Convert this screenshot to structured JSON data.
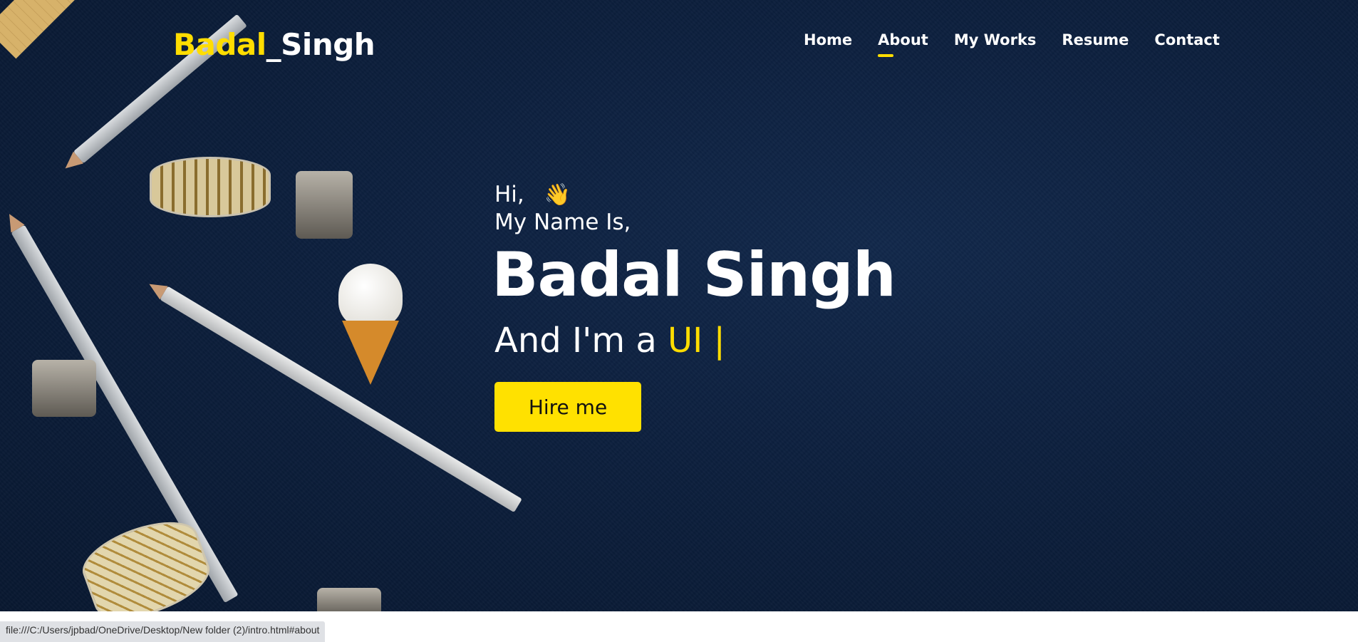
{
  "header": {
    "logo_first": "Badal",
    "logo_sep": "_",
    "logo_last": "Singh",
    "nav": [
      {
        "label": "Home"
      },
      {
        "label": "About"
      },
      {
        "label": "My Works"
      },
      {
        "label": "Resume"
      },
      {
        "label": "Contact"
      }
    ],
    "active_nav": "About"
  },
  "hero": {
    "greeting": "Hi,",
    "wave_emoji": "👋",
    "intro": "My Name Is,",
    "name": "Badal Singh",
    "role_prefix": "And I'm a",
    "role_typed": "UI |",
    "cta_label": "Hire me"
  },
  "status_bar": {
    "url": "file:///C:/Users/jpbad/OneDrive/Desktop/New folder (2)/intro.html#about"
  },
  "colors": {
    "accent": "#ffdd00",
    "background": "#0c1f3d",
    "text": "#ffffff"
  }
}
